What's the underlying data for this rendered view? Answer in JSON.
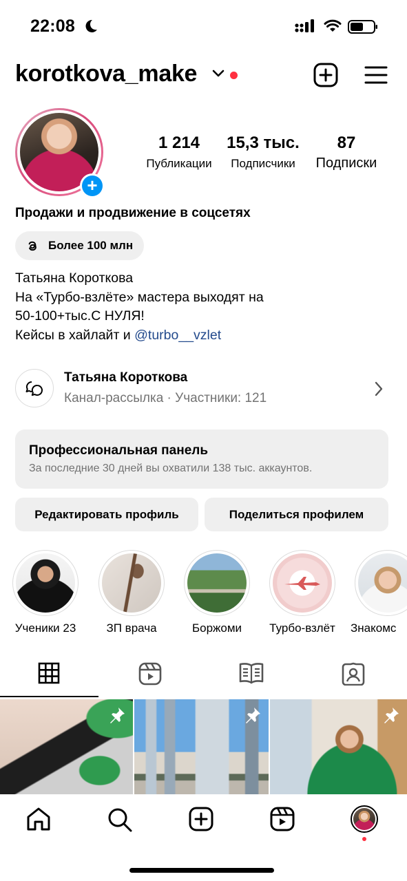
{
  "status_bar": {
    "time": "22:08"
  },
  "header": {
    "username": "korotkova_make"
  },
  "stats": [
    {
      "value": "1 214",
      "label": "Публикации"
    },
    {
      "value": "15,3 тыс.",
      "label": "Подписчики"
    },
    {
      "value": "87",
      "label": "Подписки"
    }
  ],
  "bio": {
    "category": "Продажи и продвижение в соцсетях",
    "threads": "Более 100 млн",
    "line1": "Татьяна Короткова",
    "line2": "На «Турбо-взлёте» мастера выходят на",
    "line3": "50-100+тыс.С НУЛЯ!",
    "line4_prefix": "Кейсы в хайлайт и ",
    "line4_link": "@turbo__vzlet"
  },
  "channel": {
    "name": "Татьяна Короткова",
    "subtitle": "Канал-рассылка · Участники: 121"
  },
  "pro_panel": {
    "title": "Профессиональная панель",
    "subtitle": "За последние 30 дней вы охватили 138 тыс. аккаунтов."
  },
  "buttons": {
    "edit": "Редактировать профиль",
    "share": "Поделиться профилем"
  },
  "highlights": [
    {
      "label": "Ученики 23"
    },
    {
      "label": "ЗП врача"
    },
    {
      "label": "Боржоми"
    },
    {
      "label": "Турбо-взлёт"
    },
    {
      "label": "Знакомс"
    }
  ],
  "tabs": [
    "grid-icon",
    "reels-icon",
    "guide-icon",
    "tagged-icon"
  ],
  "nav": [
    "home-icon",
    "search-icon",
    "create-icon",
    "reels-icon",
    "profile-avatar"
  ],
  "colors": {
    "accent": "#0095f6",
    "notification": "#ff3040",
    "link": "#234a8c",
    "muted": "#737373",
    "panel": "#efefef"
  }
}
